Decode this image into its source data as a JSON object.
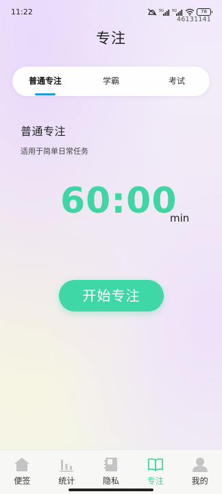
{
  "status_bar": {
    "time": "11:22",
    "battery": "78",
    "watermark": "46131141",
    "icons": [
      "mute-icon",
      "signal-5g-icon",
      "signal-5g-icon",
      "wifi-icon",
      "battery-icon"
    ]
  },
  "header": {
    "title": "专注"
  },
  "tabs": [
    {
      "label": "普通专注",
      "active": true
    },
    {
      "label": "学霸",
      "active": false
    },
    {
      "label": "考试",
      "active": false
    }
  ],
  "mode": {
    "title": "普通专注",
    "description": "适用于简单日常任务"
  },
  "timer": {
    "value": "60:00",
    "unit": "min"
  },
  "start_button": {
    "label": "开始专注"
  },
  "bottom_nav": [
    {
      "label": "便签",
      "icon": "home-icon",
      "active": false
    },
    {
      "label": "统计",
      "icon": "bar-chart-icon",
      "active": false
    },
    {
      "label": "隐私",
      "icon": "notebook-icon",
      "active": false
    },
    {
      "label": "专注",
      "icon": "open-book-icon",
      "active": true
    },
    {
      "label": "我的",
      "icon": "user-icon",
      "active": false
    }
  ],
  "colors": {
    "accent": "#3fd7a5",
    "tab_underline": "#1d9be0",
    "inactive_icon": "#c4c4c4"
  }
}
